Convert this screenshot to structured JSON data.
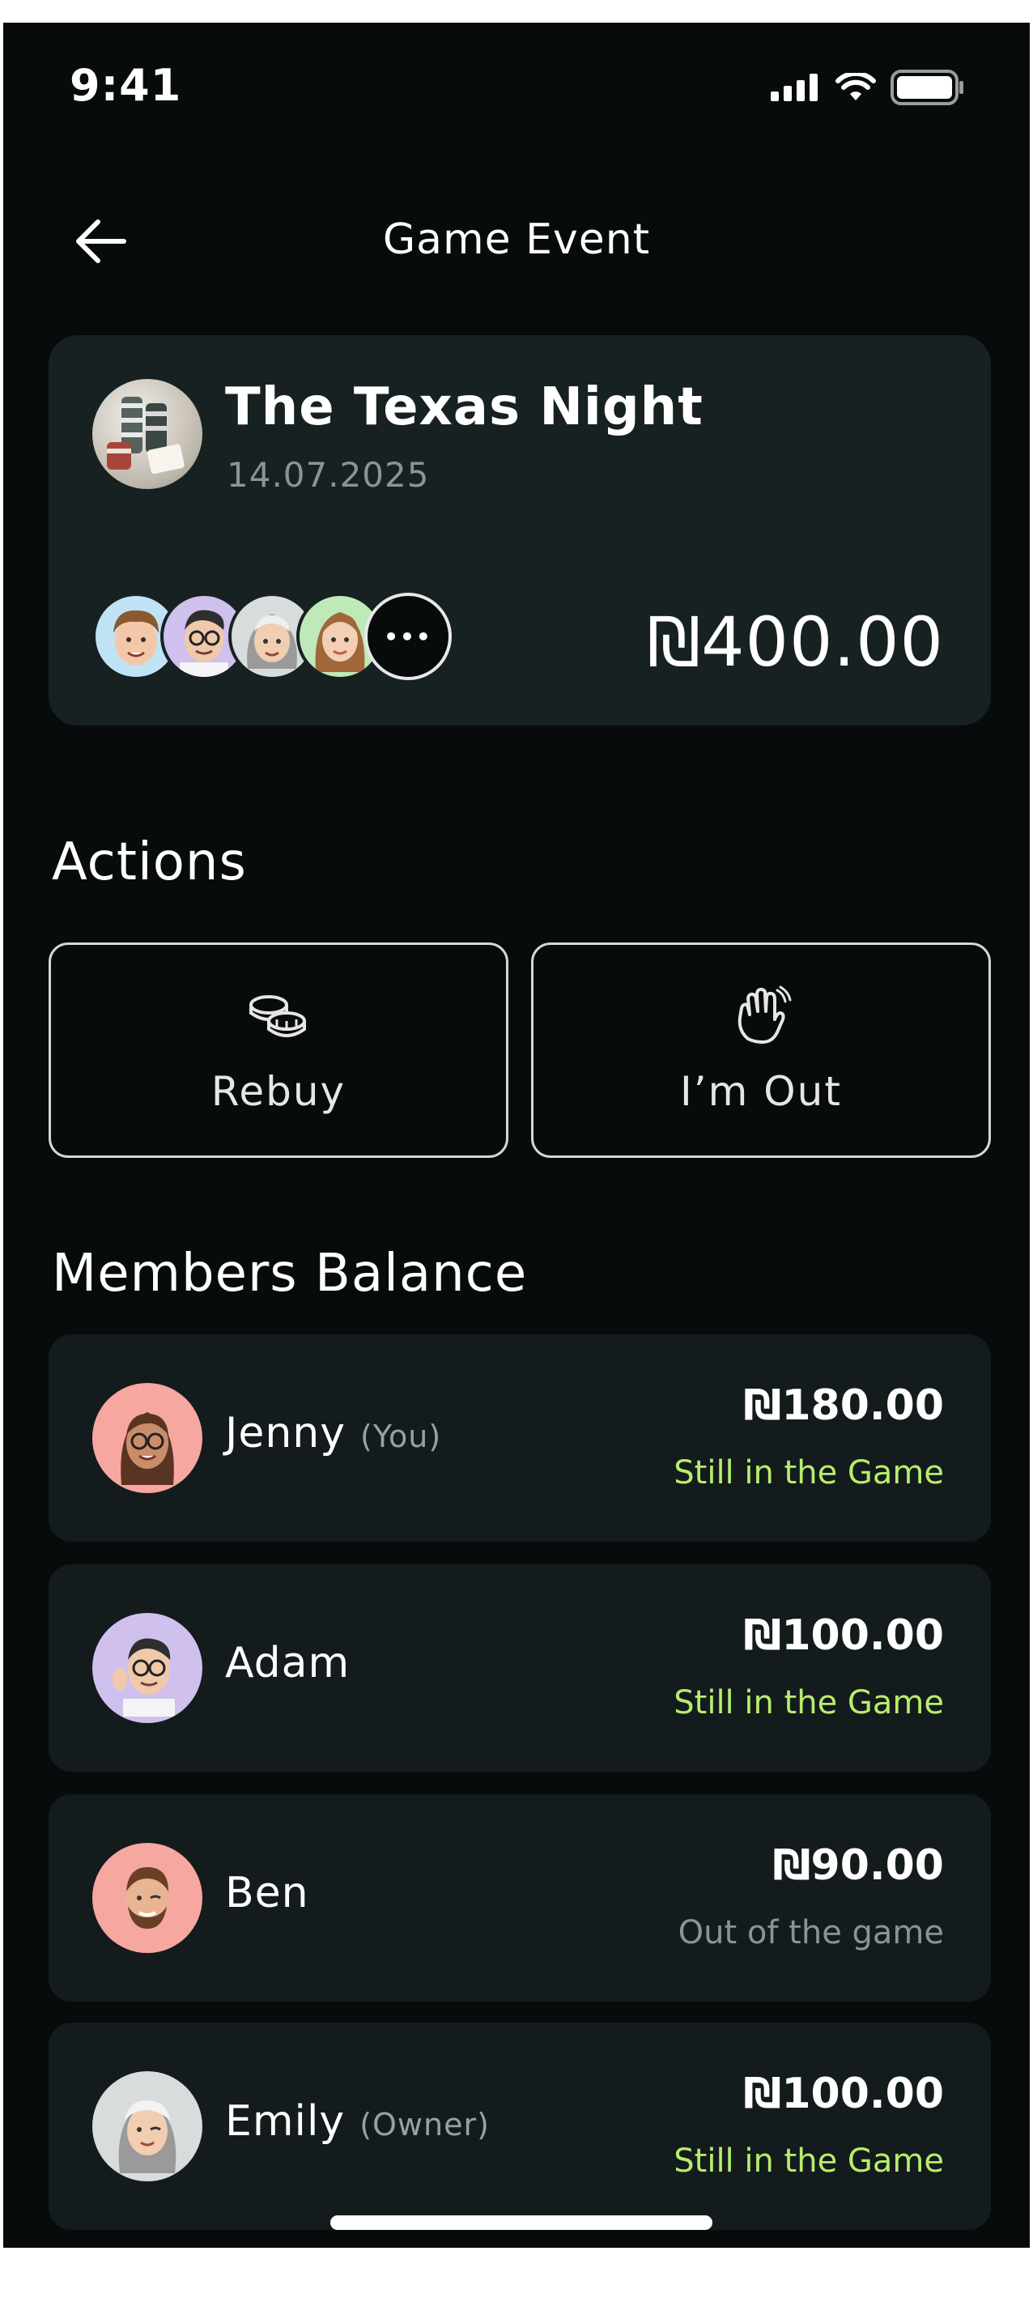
{
  "status_bar": {
    "time": "9:41"
  },
  "header": {
    "title": "Game Event"
  },
  "event": {
    "title": "The Texas Night",
    "date": "14.07.2025",
    "total": "₪400.00",
    "more_glyph": "•••",
    "participant_avatars": [
      "avatar-man-blond",
      "avatar-man-glasses",
      "avatar-woman-gray",
      "avatar-woman-brown"
    ]
  },
  "actions": {
    "title": "Actions",
    "buttons": [
      {
        "label": "Rebuy",
        "icon": "coins-icon"
      },
      {
        "label": "I’m Out",
        "icon": "waving-hand-icon"
      }
    ]
  },
  "members": {
    "title": "Members Balance",
    "items": [
      {
        "name": "Jenny",
        "tag": "(You)",
        "amount": "₪180.00",
        "status": "Still in the Game",
        "status_kind": "in",
        "avatar_bg": "#f6a7a0"
      },
      {
        "name": "Adam",
        "tag": "",
        "amount": "₪100.00",
        "status": "Still in the Game",
        "status_kind": "in",
        "avatar_bg": "#cfc0ee"
      },
      {
        "name": "Ben",
        "tag": "",
        "amount": "₪90.00",
        "status": "Out of the game",
        "status_kind": "out",
        "avatar_bg": "#f6a7a0"
      },
      {
        "name": "Emily",
        "tag": "(Owner)",
        "amount": "₪100.00",
        "status": "Still in the Game",
        "status_kind": "in",
        "avatar_bg": "#d9dcdc"
      }
    ]
  },
  "colors": {
    "background": "#070b0b",
    "card": "#172121",
    "member_card": "#141b1c",
    "status_in": "#b7ed6e",
    "status_out": "#8b9393"
  }
}
